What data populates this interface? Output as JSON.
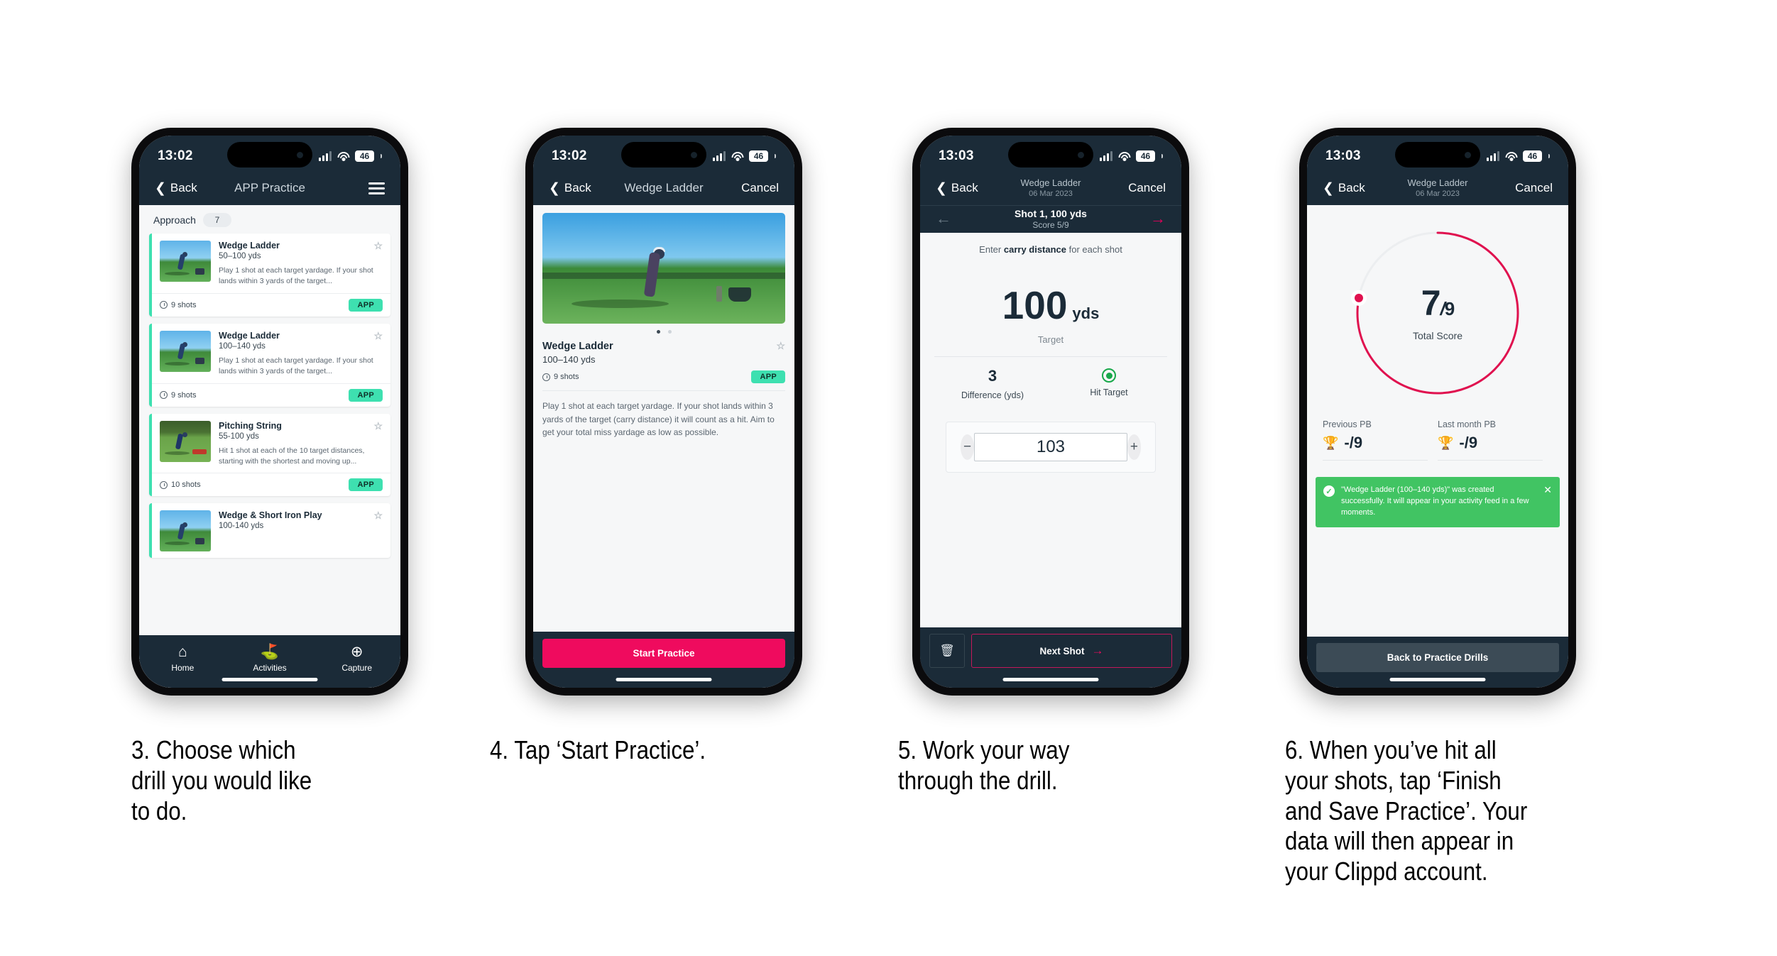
{
  "phones": [
    {
      "status": {
        "time": "13:02",
        "battery": "46",
        "signal_icon": "cellular-bars-icon",
        "wifi_icon": "wifi-icon"
      },
      "nav": {
        "back_label": "Back",
        "title": "APP Practice",
        "menu_icon": "hamburger-menu-icon"
      },
      "section": {
        "title": "Approach",
        "count": "7"
      },
      "cards": [
        {
          "title": "Wedge Ladder",
          "yards": "50–100 yds",
          "desc": "Play 1 shot at each target yardage. If your shot lands within 3 yards of the target...",
          "shots": "9 shots",
          "tag": "APP",
          "star_icon": "star-outline-icon"
        },
        {
          "title": "Wedge Ladder",
          "yards": "100–140 yds",
          "desc": "Play 1 shot at each target yardage. If your shot lands within 3 yards of the target...",
          "shots": "9 shots",
          "tag": "APP",
          "star_icon": "star-outline-icon"
        },
        {
          "title": "Pitching String",
          "yards": "55-100 yds",
          "desc": "Hit 1 shot at each of the 10 target distances, starting with the shortest and moving up...",
          "shots": "10 shots",
          "tag": "APP",
          "star_icon": "star-outline-icon"
        },
        {
          "title": "Wedge & Short Iron Play",
          "yards": "100-140 yds",
          "desc": "",
          "shots": "",
          "tag": "",
          "star_icon": "star-outline-icon"
        }
      ],
      "tabs": [
        {
          "label": "Home",
          "icon": "home-icon",
          "glyph": "⌂"
        },
        {
          "label": "Activities",
          "icon": "golf-flag-icon",
          "glyph": "⛳"
        },
        {
          "label": "Capture",
          "icon": "plus-circle-icon",
          "glyph": "⊕"
        }
      ]
    },
    {
      "status": {
        "time": "13:02",
        "battery": "46"
      },
      "nav": {
        "back_label": "Back",
        "title": "Wedge Ladder",
        "cancel_label": "Cancel"
      },
      "detail": {
        "title": "Wedge Ladder",
        "yards": "100–140 yds",
        "shots": "9 shots",
        "tag": "APP",
        "description": "Play 1 shot at each target yardage. If your shot lands within 3 yards of the target (carry distance) it will count as a hit. Aim to get your total miss yardage as low as possible.",
        "star_icon": "star-outline-icon",
        "carousel_dots": 2,
        "carousel_active": 0
      },
      "cta_label": "Start Practice"
    },
    {
      "status": {
        "time": "13:03",
        "battery": "46"
      },
      "nav": {
        "back_label": "Back",
        "title": "Wedge Ladder",
        "subtitle": "06 Mar 2023",
        "cancel_label": "Cancel"
      },
      "shotbar": {
        "shot_label": "Shot 1, 100 yds",
        "score_label": "Score 5/9",
        "prev_icon": "arrow-left-icon",
        "next_icon": "arrow-right-icon"
      },
      "entry": {
        "hint_prefix": "Enter ",
        "hint_bold": "carry distance",
        "hint_suffix": " for each shot",
        "target_value": "100",
        "target_unit": "yds",
        "target_label": "Target",
        "difference_value": "3",
        "difference_label": "Difference (yds)",
        "hit_label": "Hit Target",
        "hit_icon": "target-hit-icon",
        "stepper_value": "103",
        "minus_label": "−",
        "plus_label": "+"
      },
      "footer": {
        "delete_icon": "trash-icon",
        "next_label": "Next Shot",
        "next_arrow": "→"
      }
    },
    {
      "status": {
        "time": "13:03",
        "battery": "46"
      },
      "nav": {
        "back_label": "Back",
        "title": "Wedge Ladder",
        "subtitle": "06 Mar 2023",
        "cancel_label": "Cancel"
      },
      "summary": {
        "score_value": "7",
        "score_sep": "/",
        "score_total": "9",
        "score_label": "Total Score",
        "ring_percent": 78,
        "ring_color": "#e0114f",
        "ring_track": "#eceef0",
        "pbs": [
          {
            "label": "Previous PB",
            "value": "-/9",
            "icon": "trophy-icon"
          },
          {
            "label": "Last month PB",
            "value": "-/9",
            "icon": "trophy-icon"
          }
        ],
        "toast": {
          "text": "\"Wedge Ladder (100–140 yds)\" was created successfully. It will appear in your activity feed in a few moments.",
          "check_icon": "check-circle-icon",
          "close_icon": "close-icon",
          "color": "#41c463"
        },
        "back_label": "Back to Practice Drills"
      }
    }
  ],
  "captions": [
    "3. Choose which\ndrill you would like\nto do.",
    "4. Tap ‘Start Practice’.",
    "5. Work your way\nthrough the drill.",
    "6. When you’ve hit all\nyour shots, tap ‘Finish\nand Save Practice’. Your\ndata will then appear in\nyour Clippd account."
  ],
  "theme": {
    "header_navy": "#1b2b38",
    "accent_teal": "#3ee0b0",
    "accent_pink": "#ef0b5e",
    "success_green": "#41c463"
  }
}
